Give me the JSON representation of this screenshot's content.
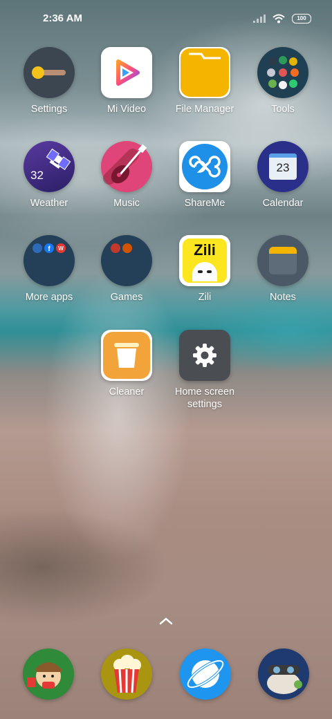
{
  "status_bar": {
    "time": "2:36 AM",
    "battery": "100"
  },
  "apps": {
    "settings": "Settings",
    "mi_video": "Mi Video",
    "file_manager": "File Manager",
    "tools": "Tools",
    "weather": "Weather",
    "weather_temp": "32",
    "music": "Music",
    "shareme": "ShareMe",
    "calendar": "Calendar",
    "calendar_day": "23",
    "more_apps": "More apps",
    "games": "Games",
    "zili": "Zili",
    "zili_logo": "Zili",
    "notes": "Notes",
    "cleaner": "Cleaner",
    "home_screen_settings": "Home screen settings"
  },
  "colors": {
    "settings_bg": "#3b4650",
    "file_manager": "#f4b400",
    "weather_bg": "#3b2a7a",
    "music_bg": "#e0457a",
    "shareme": "#1e90e8",
    "calendar_bg": "#2a2f8a",
    "folder_bg": "#243f58",
    "notes_bg": "#4b5966",
    "cleaner": "#f2a43a",
    "home_settings_bg": "#4a4d52",
    "browser": "#1e96f0"
  }
}
